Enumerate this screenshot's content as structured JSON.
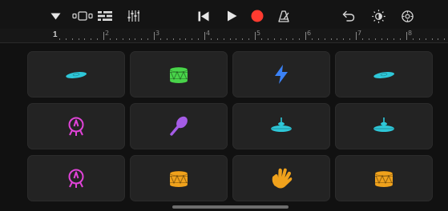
{
  "toolbar": {
    "left": [
      {
        "name": "browser-dropdown",
        "icon": "triangle-down-icon"
      },
      {
        "name": "view-toggle",
        "icon": "tracks-view-icon"
      },
      {
        "name": "track-list",
        "icon": "list-icon"
      },
      {
        "name": "mixer",
        "icon": "sliders-icon"
      }
    ],
    "transport": [
      {
        "name": "go-to-beginning",
        "icon": "skip-back-icon"
      },
      {
        "name": "play",
        "icon": "play-icon"
      },
      {
        "name": "record",
        "icon": "record-icon",
        "color": "#ff3b30"
      },
      {
        "name": "metronome",
        "icon": "metronome-icon"
      }
    ],
    "right": [
      {
        "name": "undo",
        "icon": "undo-icon"
      },
      {
        "name": "master-effects",
        "icon": "brightness-icon"
      },
      {
        "name": "settings",
        "icon": "gear-icon"
      }
    ]
  },
  "ruler": {
    "playhead_bar": "1",
    "bar_numbers": [
      "2",
      "3",
      "4",
      "5",
      "6",
      "7",
      "8"
    ]
  },
  "pads": [
    {
      "instrument": "cymbal",
      "icon": "cymbal-icon",
      "color": "#2ec7d8"
    },
    {
      "instrument": "snare-drum",
      "icon": "drum-icon",
      "color": "#49d44a"
    },
    {
      "instrument": "electronic",
      "icon": "lightning-icon",
      "color": "#3b82f6"
    },
    {
      "instrument": "cymbal",
      "icon": "cymbal-icon",
      "color": "#2ec7d8"
    },
    {
      "instrument": "hi-hat-kit",
      "icon": "kick-stand-icon",
      "color": "#e043d8"
    },
    {
      "instrument": "shaker",
      "icon": "maraca-icon",
      "color": "#a55ce6"
    },
    {
      "instrument": "hi-hat",
      "icon": "hihat-icon",
      "color": "#2ec7d8"
    },
    {
      "instrument": "hi-hat",
      "icon": "hihat-icon",
      "color": "#2ec7d8"
    },
    {
      "instrument": "kick-drum",
      "icon": "kick-stand-icon",
      "color": "#e043d8"
    },
    {
      "instrument": "tom",
      "icon": "drum-icon",
      "color": "#f0a21c"
    },
    {
      "instrument": "clap",
      "icon": "hand-icon",
      "color": "#f0a21c"
    },
    {
      "instrument": "tom",
      "icon": "drum-icon",
      "color": "#f0a21c"
    }
  ]
}
